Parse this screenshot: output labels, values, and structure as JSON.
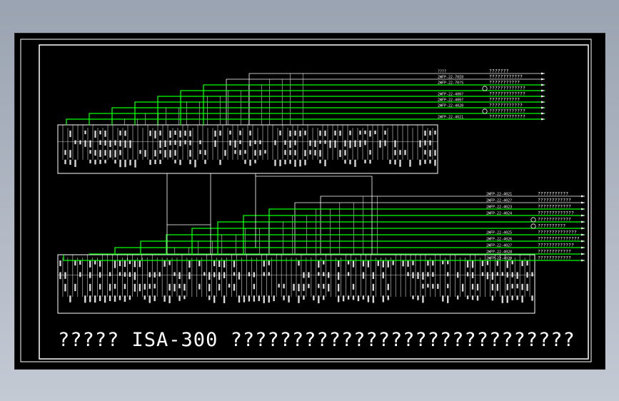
{
  "drawing": {
    "title": "????? ISA-300 ????????????????????????????",
    "colors": {
      "background": "#000000",
      "border": "#ffffff",
      "wire": "#00ff00",
      "text": "#ffffff"
    },
    "upper_group": {
      "cables": [
        {
          "code": "????",
          "spec": "???????"
        },
        {
          "code": "2WFP-22-70I0",
          "spec": "????????????"
        },
        {
          "code": "2WFP-22-70?S",
          "spec": "???????????"
        },
        {
          "code": "",
          "spec": "?????????????"
        },
        {
          "code": "2WFP-22-400?",
          "spec": "?????????????"
        },
        {
          "code": "2WFP-22-400?",
          "spec": "???????????"
        },
        {
          "code": "2WFP-22-4020",
          "spec": "????????????"
        },
        {
          "code": "",
          "spec": "?????????????"
        },
        {
          "code": "2WFP-22-4021",
          "spec": "?????????????"
        }
      ]
    },
    "lower_group": {
      "cables": [
        {
          "code": "2WFP-22-4021",
          "spec": "???????????"
        },
        {
          "code": "2WFP-22-402?",
          "spec": "????????????"
        },
        {
          "code": "2WFP-22-4023",
          "spec": "????????????"
        },
        {
          "code": "2WFP-22-4024",
          "spec": "?????????????"
        },
        {
          "code": "",
          "spec": "????????????"
        },
        {
          "code": "",
          "spec": "??????????"
        },
        {
          "code": "2WFP-22-4025",
          "spec": "??????????????"
        },
        {
          "code": "2WFP-22-4026",
          "spec": "???????????????"
        },
        {
          "code": "2WFP-22-402?",
          "spec": "?????????????"
        },
        {
          "code": "2WFP-22-4028",
          "spec": "????????????"
        },
        {
          "code": "2WFP-22-4029",
          "spec": "????????????"
        }
      ]
    }
  }
}
